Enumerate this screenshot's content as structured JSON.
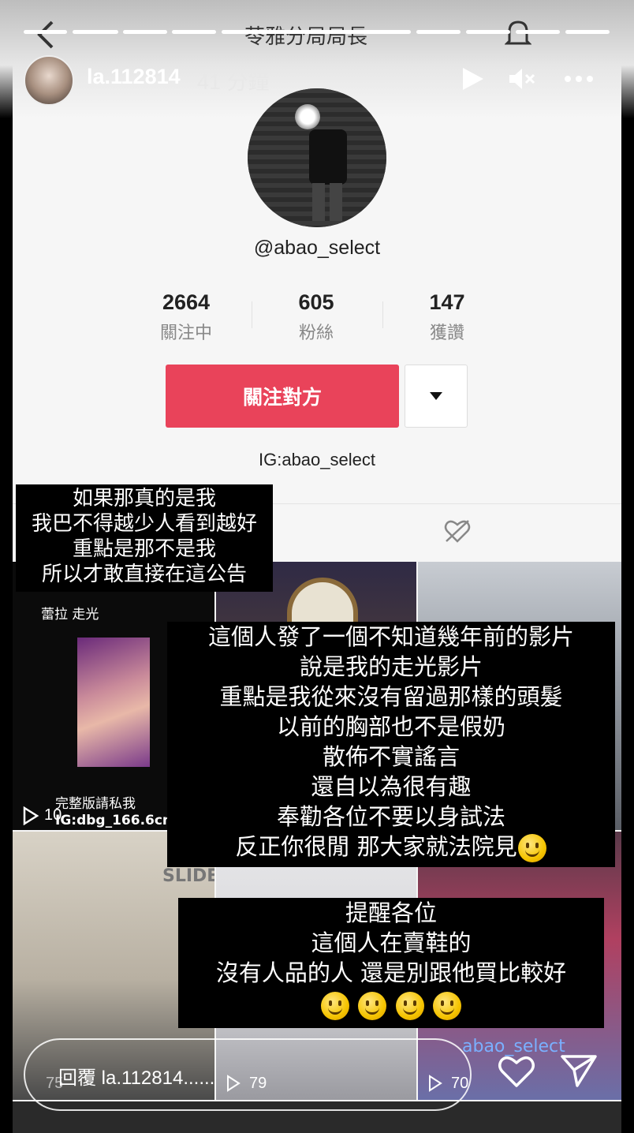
{
  "story": {
    "username": "la.112814",
    "time_ago": "41 分鐘",
    "background_title": "苓雅分局局長",
    "reply_placeholder": "回覆 la.112814......"
  },
  "profile": {
    "handle": "@abao_select",
    "stats": [
      {
        "value": "2664",
        "label": "關注中"
      },
      {
        "value": "605",
        "label": "粉絲"
      },
      {
        "value": "147",
        "label": "獲讚"
      }
    ],
    "follow_label": "關注對方",
    "bio": "IG:abao_select"
  },
  "grid": {
    "thumb1_caption": "蕾拉 走光",
    "thumb1_footer": "完整版請私我",
    "thumb1_footer2": "IG:dbg_166.6cm",
    "thumb1_count": "10",
    "thumb_slide": "SLIDE",
    "watermark": "abao_select",
    "counts": [
      "75",
      "79",
      "70"
    ]
  },
  "overlays": {
    "box1": [
      "如果那真的是我",
      "我巴不得越少人看到越好",
      "重點是那不是我",
      "所以才敢直接在這公告"
    ],
    "box2": [
      "這個人發了一個不知道幾年前的影片",
      "說是我的走光影片",
      "重點是我從來沒有留過那樣的頭髮",
      "以前的胸部也不是假奶",
      "散佈不實謠言",
      "還自以為很有趣",
      "奉勸各位不要以身試法",
      "反正你很閒 那大家就法院見"
    ],
    "box3": [
      "提醒各位",
      "這個人在賣鞋的",
      "沒有人品的人 還是別跟他買比較好"
    ]
  },
  "colors": {
    "follow_button": "#e9435a",
    "overlay_bg": "#000000"
  },
  "icons": [
    "back-icon",
    "bell-icon",
    "play-icon",
    "mute-icon",
    "more-icon",
    "caret-down-icon",
    "liked-hidden-icon",
    "heart-icon",
    "send-icon",
    "smile-emoji"
  ]
}
